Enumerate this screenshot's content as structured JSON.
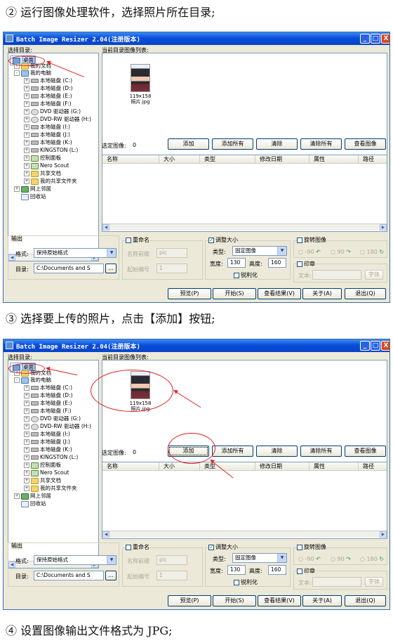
{
  "steps": {
    "step2": "② 运行图像处理软件，选择照片所在目录;",
    "step3": "③ 选择要上传的照片，点击【添加】按钮;",
    "step4": "④ 设置图像输出文件格式为 JPG;"
  },
  "window": {
    "title": "Batch Image Resizer 2.04(注册版本)",
    "minimize": "_",
    "maximize": "□",
    "close": "X"
  },
  "tree": {
    "label": "选择目录:",
    "items": [
      "桌面",
      "我的文档",
      "我的电脑",
      "本地磁盘 (C:)",
      "本地磁盘 (D:)",
      "本地磁盘 (E:)",
      "本地磁盘 (F:)",
      "DVD 驱动器 (G:)",
      "DVD-RW 驱动器 (H:)",
      "本地磁盘 (I:)",
      "本地磁盘 (J:)",
      "本地磁盘 (K:)",
      "KINGSTON (L:)",
      "控制面板",
      "Nero Scout",
      "共享文档",
      "我的共享文件夹",
      "网上邻居",
      "回收站"
    ]
  },
  "images": {
    "label": "当前目录图像列表:",
    "thumb_size": "119x158",
    "thumb_name": "照片.jpg"
  },
  "selected": {
    "label": "选定图像:",
    "count": "0",
    "buttons": [
      "添加",
      "添加所有",
      "清除",
      "清除所有",
      "查看图像"
    ],
    "columns": [
      "名称",
      "大小",
      "类型",
      "修改日期",
      "属性",
      "路径"
    ]
  },
  "output": {
    "group": "输出",
    "format_label": "格式:",
    "format_value": "保持原始格式",
    "dir_label": "目录:",
    "dir_value": "C:\\Documents and S",
    "browse": "..."
  },
  "rename": {
    "group": "重命名",
    "prefix_label": "名称前缀",
    "prefix_value": "pic",
    "start_label": "起始编号",
    "start_value": "1"
  },
  "resize": {
    "group": "调整大小",
    "type_label": "类型:",
    "type_value": "固定图像",
    "width_label": "宽度:",
    "width_value": "130",
    "height_label": "高度:",
    "height_value": "160",
    "sharpen": "锐利化",
    "check": "✓"
  },
  "rotate": {
    "group": "旋转图像",
    "options": [
      "-90",
      "90",
      "180"
    ]
  },
  "stamp": {
    "group": "印章",
    "text_label": "文本:",
    "font_button": "字体"
  },
  "bottom_buttons": [
    "预览(P)",
    "开始(S)",
    "查看结果(V)",
    "关于(A)",
    "退出(Q)"
  ]
}
